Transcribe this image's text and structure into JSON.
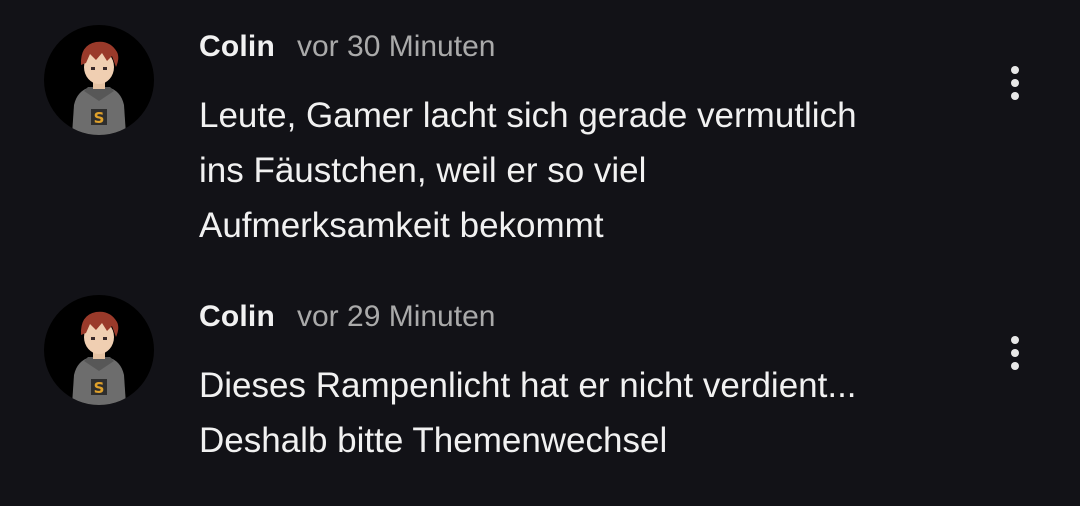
{
  "comments": [
    {
      "author": "Colin",
      "time": "vor 30 Minuten",
      "lines": [
        "Leute, Gamer lacht sich gerade vermutlich",
        "ins Fäustchen, weil er so viel",
        "Aufmerksamkeit bekommt"
      ],
      "avatar_badge": "S"
    },
    {
      "author": "Colin",
      "time": "vor 29 Minuten",
      "lines": [
        "Dieses Rampenlicht hat er nicht verdient...",
        "Deshalb bitte Themenwechsel"
      ],
      "avatar_badge": "S"
    }
  ],
  "icons": {
    "menu": "more-vert-icon"
  },
  "colors": {
    "background": "#121217",
    "text_primary": "#f1f1f1",
    "text_secondary": "#aaaaaa",
    "avatar_bg": "#000000"
  }
}
